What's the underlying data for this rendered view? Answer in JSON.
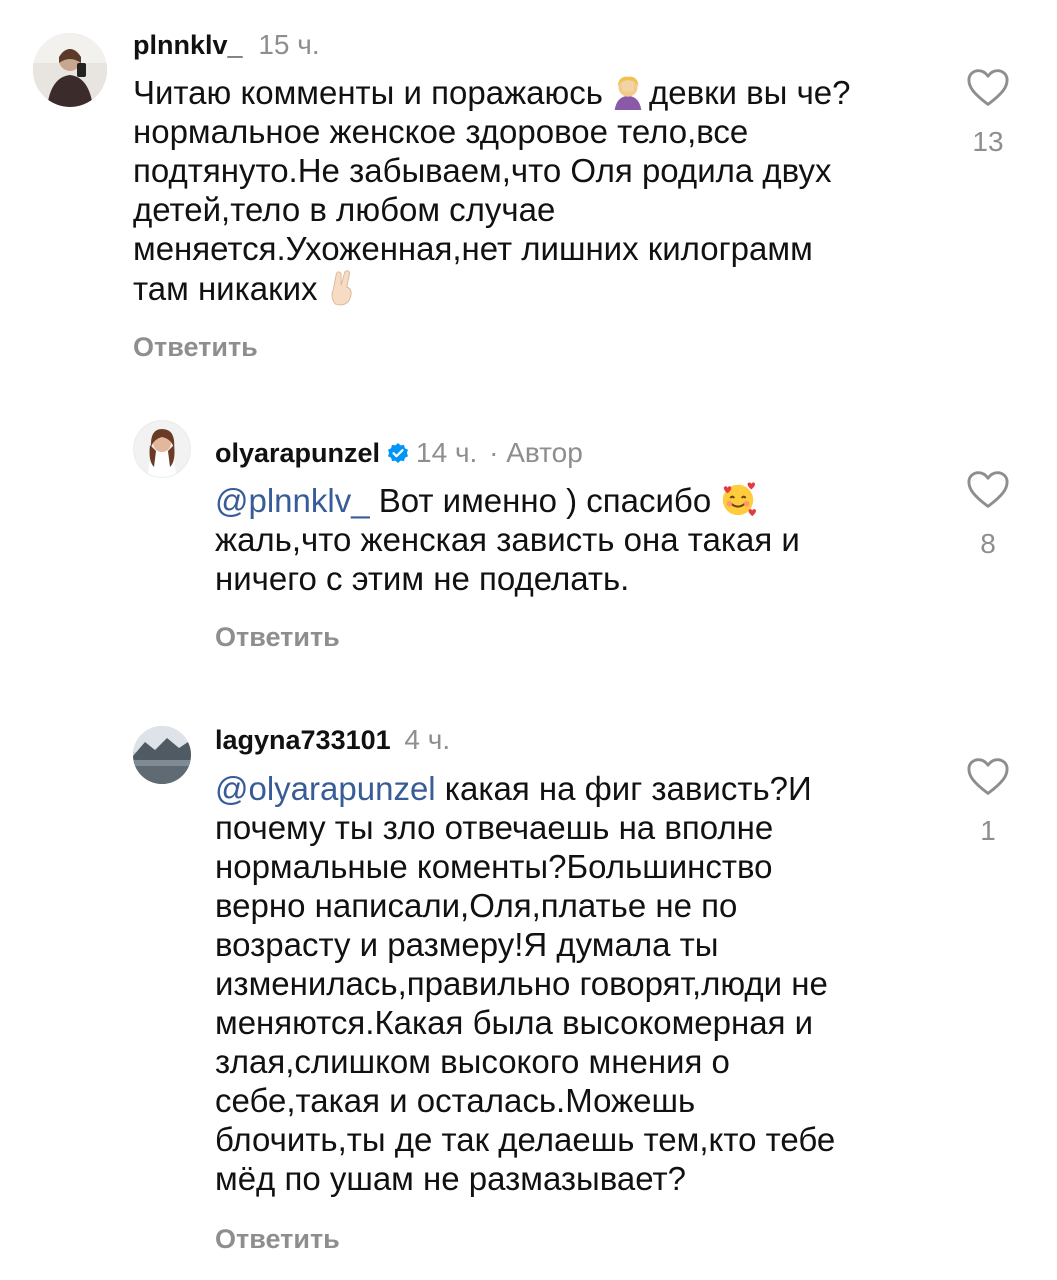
{
  "comments": [
    {
      "username": "plnnklv_",
      "time": "15 ч.",
      "lines": [
        "Читаю комменты и поражаюсь",
        "девки вы че?",
        "нормальное женское здоровое тело,все",
        "подтянуто.Не забываем,что Оля родила двух",
        "детей,тело в любом случае",
        "меняется.Ухоженная,нет лишних килограмм",
        "там никаких"
      ],
      "emojis": [
        "face-palm-emoji",
        "crossed-fingers-emoji"
      ],
      "reply_label": "Ответить",
      "likes": "13"
    },
    {
      "username": "olyarapunzel",
      "verified": true,
      "time": "14 ч.",
      "author_label": "· Автор",
      "mention": "@plnnklv_",
      "lines": [
        "Вот именно ) спасибо",
        "жаль,что женская зависть она такая и",
        "ничего с этим не поделать."
      ],
      "emojis": [
        "smiling-face-with-hearts-emoji"
      ],
      "reply_label": "Ответить",
      "likes": "8"
    },
    {
      "username": "lagyna733101",
      "time": "4 ч.",
      "mention": "@olyarapunzel",
      "lines": [
        "какая на фиг зависть?И",
        "почему ты зло отвечаешь на вполне",
        "нормальные коменты?Большинство",
        "верно написали,Оля,платье не по",
        "возрасту и размеру!Я думала ты",
        "изменилась,правильно говорят,люди не",
        "меняются.Какая была высокомерная и",
        "злая,слишком высокого мнения о",
        "себе,такая и осталась.Можешь",
        "блочить,ты де так делаешь тем,кто тебе",
        "мёд по ушам не размазывает?"
      ],
      "reply_label": "Ответить",
      "likes": "1"
    }
  ],
  "colors": {
    "text": "#111111",
    "meta": "#8e8e8e",
    "mention": "#385c97",
    "verified": "#0095f6"
  }
}
